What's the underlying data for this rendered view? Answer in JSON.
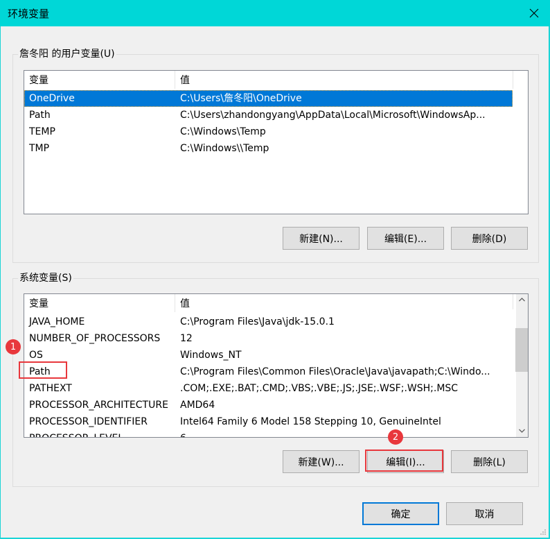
{
  "window": {
    "title": "环境变量",
    "accent_color": "#00d7d7"
  },
  "user_vars": {
    "legend": "詹冬阳 的用户变量(U)",
    "columns": [
      "变量",
      "值"
    ],
    "rows": [
      {
        "name": "OneDrive",
        "value": "C:\\Users\\詹冬阳\\OneDrive",
        "selected": true
      },
      {
        "name": "Path",
        "value": "C:\\Users\\zhandongyang\\AppData\\Local\\Microsoft\\WindowsAp..."
      },
      {
        "name": "TEMP",
        "value": "C:\\Windows\\Temp"
      },
      {
        "name": "TMP",
        "value": "C:\\Windows\\\\Temp"
      }
    ],
    "buttons": {
      "new": "新建(N)...",
      "edit": "编辑(E)...",
      "delete": "删除(D)"
    }
  },
  "system_vars": {
    "legend": "系统变量(S)",
    "columns": [
      "变量",
      "值"
    ],
    "rows": [
      {
        "name": "JAVA_HOME",
        "value": "C:\\Program Files\\Java\\jdk-15.0.1"
      },
      {
        "name": "NUMBER_OF_PROCESSORS",
        "value": "12"
      },
      {
        "name": "OS",
        "value": "Windows_NT"
      },
      {
        "name": "Path",
        "value": "C:\\Program Files\\Common Files\\Oracle\\Java\\javapath;C:\\Windo..."
      },
      {
        "name": "PATHEXT",
        "value": ".COM;.EXE;.BAT;.CMD;.VBS;.VBE;.JS;.JSE;.WSF;.WSH;.MSC"
      },
      {
        "name": "PROCESSOR_ARCHITECTURE",
        "value": "AMD64"
      },
      {
        "name": "PROCESSOR_IDENTIFIER",
        "value": "Intel64 Family 6 Model 158 Stepping 10, GenuineIntel"
      },
      {
        "name": "PROCESSOR_LEVEL",
        "value": "6"
      }
    ],
    "buttons": {
      "new": "新建(W)...",
      "edit": "编辑(I)...",
      "delete": "删除(L)"
    }
  },
  "footer": {
    "ok": "确定",
    "cancel": "取消"
  },
  "annotations": [
    {
      "label": "1",
      "target": "Path (system variable)"
    },
    {
      "label": "2",
      "target": "编辑(I)... button"
    }
  ],
  "icons": {
    "close": "close-icon",
    "scroll_up": "chevron-up-icon",
    "scroll_down": "chevron-down-icon"
  }
}
